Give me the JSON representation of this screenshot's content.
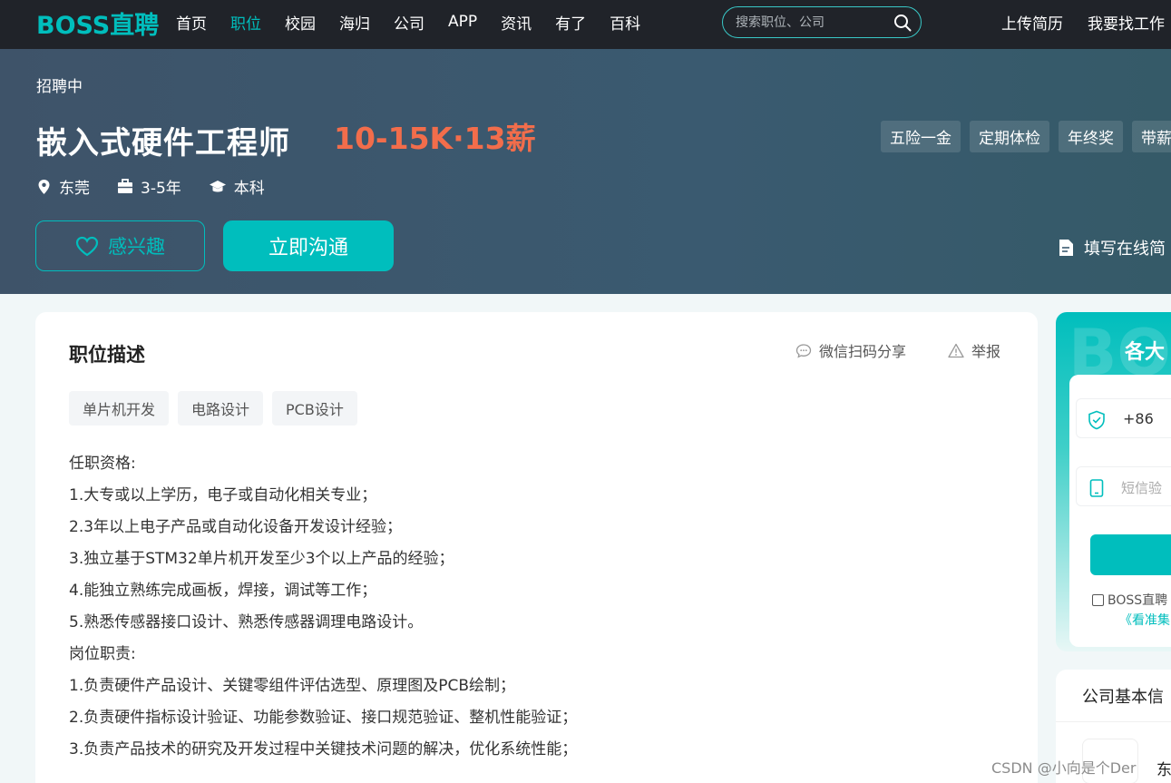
{
  "header": {
    "logo": "BOSS直聘",
    "nav": [
      "首页",
      "职位",
      "校园",
      "海归",
      "公司",
      "APP",
      "资讯",
      "有了",
      "百科"
    ],
    "active_nav_index": 1,
    "search": {
      "placeholder": "搜索职位、公司"
    },
    "upload_resume": "上传简历",
    "find_job": "我要找工作"
  },
  "job": {
    "status": "招聘中",
    "title": "嵌入式硬件工程师",
    "salary": "10-15K·13薪",
    "benefits": [
      "五险一金",
      "定期体检",
      "年终奖",
      "带薪"
    ],
    "location": "东莞",
    "experience": "3-5年",
    "education": "本科",
    "interest_label": "感兴趣",
    "chat_label": "立即沟通",
    "fill_resume_label": "填写在线简"
  },
  "description": {
    "title": "职位描述",
    "share_label": "微信扫码分享",
    "report_label": "举报",
    "skills": [
      "单片机开发",
      "电路设计",
      "PCB设计"
    ],
    "lines": [
      "任职资格:",
      "1.大专或以上学历，电子或自动化相关专业；",
      "2.3年以上电子产品或自动化设备开发设计经验；",
      "3.独立基于STM32单片机开发至少3个以上产品的经验；",
      "4.能独立熟练完成画板，焊接，调试等工作；",
      "5.熟悉传感器接口设计、熟悉传感器调理电路设计。",
      "岗位职责:",
      "1.负责硬件产品设计、关键零组件评估选型、原理图及PCB绘制；",
      "2.负责硬件指标设计验证、功能参数验证、接口规范验证、整机性能验证；",
      "3.负责产品技术的研究及开发过程中关键技术问题的解决，优化系统性能；"
    ]
  },
  "sidebar": {
    "watermark": "BOS",
    "title": "各大",
    "phone_prefix": "+86",
    "sms_placeholder": "短信验",
    "agree_text": "BOSS直聘",
    "agree_link": "《看准集",
    "company_title": "公司基本信",
    "company_name": "东"
  },
  "watermark": "CSDN @小向是个Der",
  "colors": {
    "brand": "#00bebd",
    "salary": "#f26d4b",
    "nav_bg": "#202329"
  }
}
